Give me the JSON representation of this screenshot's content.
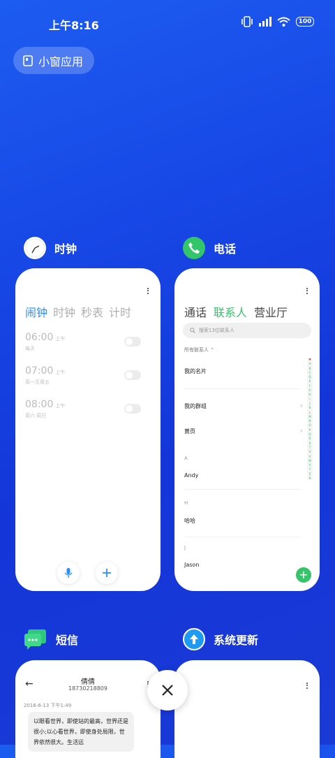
{
  "status_bar": {
    "time": "上午8:16",
    "battery": "100"
  },
  "small_window_button": {
    "label": "小窗应用"
  },
  "clock": {
    "app_name": "时钟",
    "tabs": [
      "闹钟",
      "时钟",
      "秒表",
      "计时"
    ],
    "alarms": [
      {
        "time": "06:00",
        "ampm": "上午",
        "repeat": "每天"
      },
      {
        "time": "07:00",
        "ampm": "上午",
        "repeat": "周一至周五"
      },
      {
        "time": "08:00",
        "ampm": "上午",
        "repeat": "周六 周日"
      }
    ]
  },
  "phone": {
    "app_name": "电话",
    "tabs": [
      "通话",
      "联系人",
      "营业厅"
    ],
    "search_placeholder": "搜索13位联系人",
    "all_contacts": "所有联系人",
    "rows": {
      "my_card": "我的名片",
      "my_groups": "我的群组",
      "yellow_pages": "黄页",
      "letter_a": "A",
      "andy": "Andy",
      "letter_h": "H",
      "haha": "哈哈",
      "letter_j": "J",
      "jason": "Jason"
    },
    "alpha_index": [
      "♥",
      "A",
      "B",
      "C",
      "D",
      "E",
      "F",
      "G",
      "H",
      "I",
      "J",
      "K",
      "L",
      "M",
      "N",
      "O",
      "P",
      "Q",
      "R",
      "S",
      "T",
      "U",
      "V",
      "W",
      "X",
      "Y",
      "Z",
      "#"
    ]
  },
  "sms": {
    "app_name": "短信",
    "contact_name": "倩倩",
    "contact_number": "18730218809",
    "date": "2016-6-13 下午1:49",
    "message": "以眼看世界，即使站的最高，世界还是很小;以心看世界，即使身处局限，世界依然很大。生活远"
  },
  "update": {
    "app_name": "系统更新"
  },
  "colors": {
    "accent_blue": "#2b8ef7",
    "accent_green": "#36c46a",
    "background": "#1748e6"
  }
}
